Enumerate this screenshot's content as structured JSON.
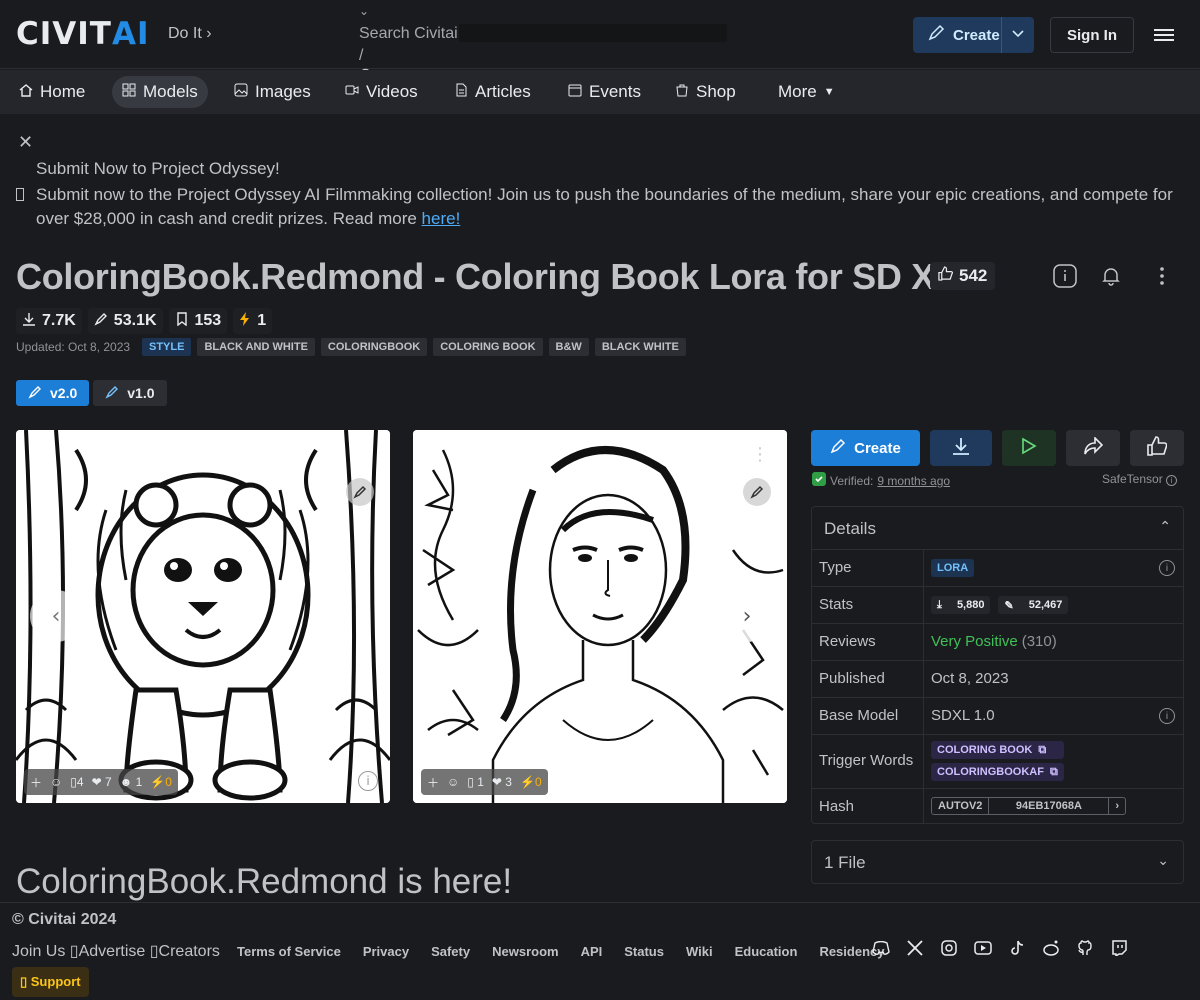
{
  "header": {
    "logo_civ": "CIVIT",
    "logo_ai": "AI",
    "doit": "Do It",
    "search_placeholder": "Search Civitai",
    "search_slash": "/",
    "create_label": "Create",
    "signin_label": "Sign In"
  },
  "nav": {
    "items": [
      {
        "label": "Home",
        "icon": "home-icon"
      },
      {
        "label": "Models",
        "icon": "grid-icon"
      },
      {
        "label": "Images",
        "icon": "image-icon"
      },
      {
        "label": "Videos",
        "icon": "video-icon"
      },
      {
        "label": "Articles",
        "icon": "article-icon"
      },
      {
        "label": "Events",
        "icon": "calendar-icon"
      },
      {
        "label": "Shop",
        "icon": "shop-icon"
      }
    ],
    "more_label": "More"
  },
  "banner": {
    "title": "Submit Now to Project Odyssey!",
    "body": "Submit now to the Project Odyssey AI Filmmaking collection! Join us to push the boundaries of the medium, share your epic creations, and compete for over $28,000 in cash and credit prizes. Read more ",
    "link": "here!"
  },
  "model": {
    "title": "ColoringBook.Redmond - Coloring Book Lora for SD XL",
    "likes": "542",
    "stats": {
      "downloads": "7.7K",
      "generations": "53.1K",
      "bookmarks": "153",
      "buzz": "1"
    },
    "updated": "Updated: Oct 8, 2023",
    "tags": [
      "STYLE",
      "BLACK AND WHITE",
      "COLORINGBOOK",
      "COLORING BOOK",
      "B&W",
      "BLACK WHITE"
    ],
    "versions": [
      "v2.0",
      "v1.0"
    ]
  },
  "gallery": [
    {
      "reactions": {
        "comments": "4",
        "hearts": "7",
        "laughs": "1",
        "buzz": "0"
      }
    },
    {
      "reactions": {
        "comments": "1",
        "hearts": "3",
        "buzz": "0"
      }
    }
  ],
  "actions": {
    "create_label": "Create",
    "verified_label": "Verified:",
    "verified_time": "9 months ago",
    "safetensor": "SafeTensor"
  },
  "details": {
    "heading": "Details",
    "rows": {
      "type_k": "Type",
      "type_v": "LORA",
      "stats_k": "Stats",
      "stats_dl": "5,880",
      "stats_gen": "52,467",
      "reviews_k": "Reviews",
      "reviews_v": "Very Positive",
      "reviews_count": "(310)",
      "published_k": "Published",
      "published_v": "Oct 8, 2023",
      "base_k": "Base Model",
      "base_v": "SDXL 1.0",
      "trigger_k": "Trigger Words",
      "trigger_1": "COLORING BOOK",
      "trigger_2": "COLORINGBOOKAF",
      "hash_k": "Hash",
      "hash_type": "AUTOV2",
      "hash_v": "94EB17068A"
    }
  },
  "files": {
    "label": "1 File"
  },
  "description": {
    "title": "ColoringBook.Redmond is here!"
  },
  "footer": {
    "copyright": "© Civitai 2024",
    "left_links": "Join Us ▯Advertise ▯Creators",
    "links": [
      "Terms of Service",
      "Privacy",
      "Safety",
      "Newsroom",
      "API",
      "Status",
      "Wiki",
      "Education",
      "Residency"
    ],
    "support": "▯ Support"
  },
  "colors": {
    "accent": "#228be6",
    "bg": "#1a1b1e",
    "positive": "#40c057",
    "buzz": "#fab005"
  }
}
